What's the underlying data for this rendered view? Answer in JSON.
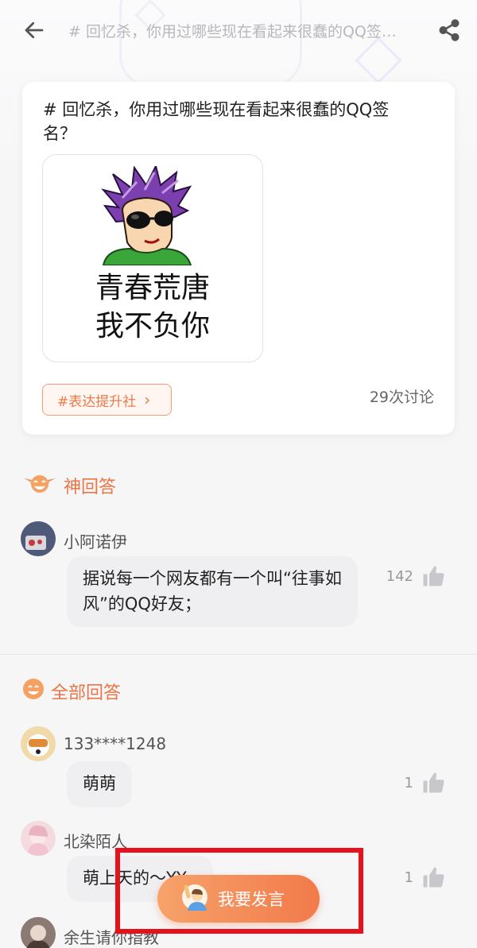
{
  "header": {
    "title": "# 回忆杀，你用过哪些现在看起来很蠢的QQ签…",
    "back_icon": "back-arrow-icon",
    "share_icon": "share-icon"
  },
  "question": {
    "title": "# 回忆杀，你用过哪些现在看起来很蠢的QQ签名？",
    "meme_line1": "青春荒唐",
    "meme_line2": "我不负你",
    "topic_tag": "#表达提升社",
    "discussion_count": "29次讨论"
  },
  "best_answer": {
    "section_title": "神回答",
    "user": "小阿诺伊",
    "text": "据说每一个网友都有一个叫“往事如风”的QQ好友；",
    "likes": "142"
  },
  "all_answers": {
    "section_title": "全部回答",
    "items": [
      {
        "user": "133****1248",
        "text": "萌萌",
        "likes": "1"
      },
      {
        "user": "北染陌人",
        "text": "萌上天的～YY",
        "likes": "1"
      },
      {
        "user": "余生请你指教"
      }
    ]
  },
  "speak_button": {
    "label": "我要发言"
  },
  "colors": {
    "accent": "#ec7445",
    "highlight": "#e8101a",
    "bubble": "#efeff1"
  }
}
